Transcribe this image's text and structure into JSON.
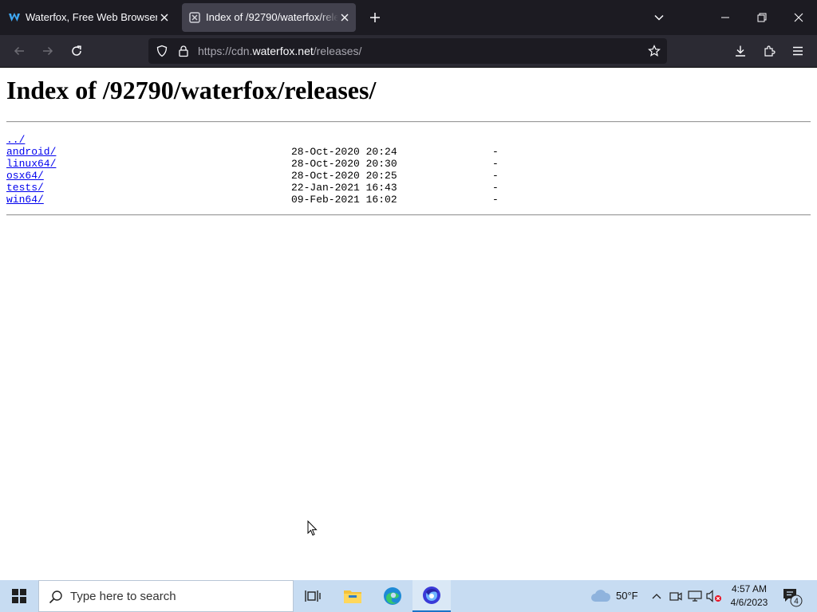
{
  "browser": {
    "tabs": [
      {
        "title": "Waterfox, Free Web Browser",
        "active": false,
        "favicon": "waterfox-logo-icon"
      },
      {
        "title": "Index of /92790/waterfox/releases/",
        "active": true,
        "favicon": "cdn-favicon-icon"
      }
    ],
    "url": {
      "prefix": "https://cdn.",
      "host": "waterfox.net",
      "path": "/releases/"
    },
    "colors": {
      "tabstrip": "#1c1b22",
      "active_tab": "#42414d",
      "toolbar": "#2b2a33",
      "urlbar": "#1c1b22",
      "link": "#0000ee"
    }
  },
  "page": {
    "heading": "Index of /92790/waterfox/releases/",
    "entries": [
      {
        "name": "../",
        "date": "",
        "size": ""
      },
      {
        "name": "android/",
        "date": "28-Oct-2020 20:24",
        "size": "-"
      },
      {
        "name": "linux64/",
        "date": "28-Oct-2020 20:30",
        "size": "-"
      },
      {
        "name": "osx64/",
        "date": "28-Oct-2020 20:25",
        "size": "-"
      },
      {
        "name": "tests/",
        "date": "22-Jan-2021 16:43",
        "size": "-"
      },
      {
        "name": "win64/",
        "date": "09-Feb-2021 16:02",
        "size": "-"
      }
    ]
  },
  "taskbar": {
    "search_placeholder": "Type here to search",
    "weather_temp": "50°F",
    "time": "4:57 AM",
    "date": "4/6/2023",
    "notification_count": "4",
    "colors": {
      "background": "#c7dcf2"
    }
  }
}
